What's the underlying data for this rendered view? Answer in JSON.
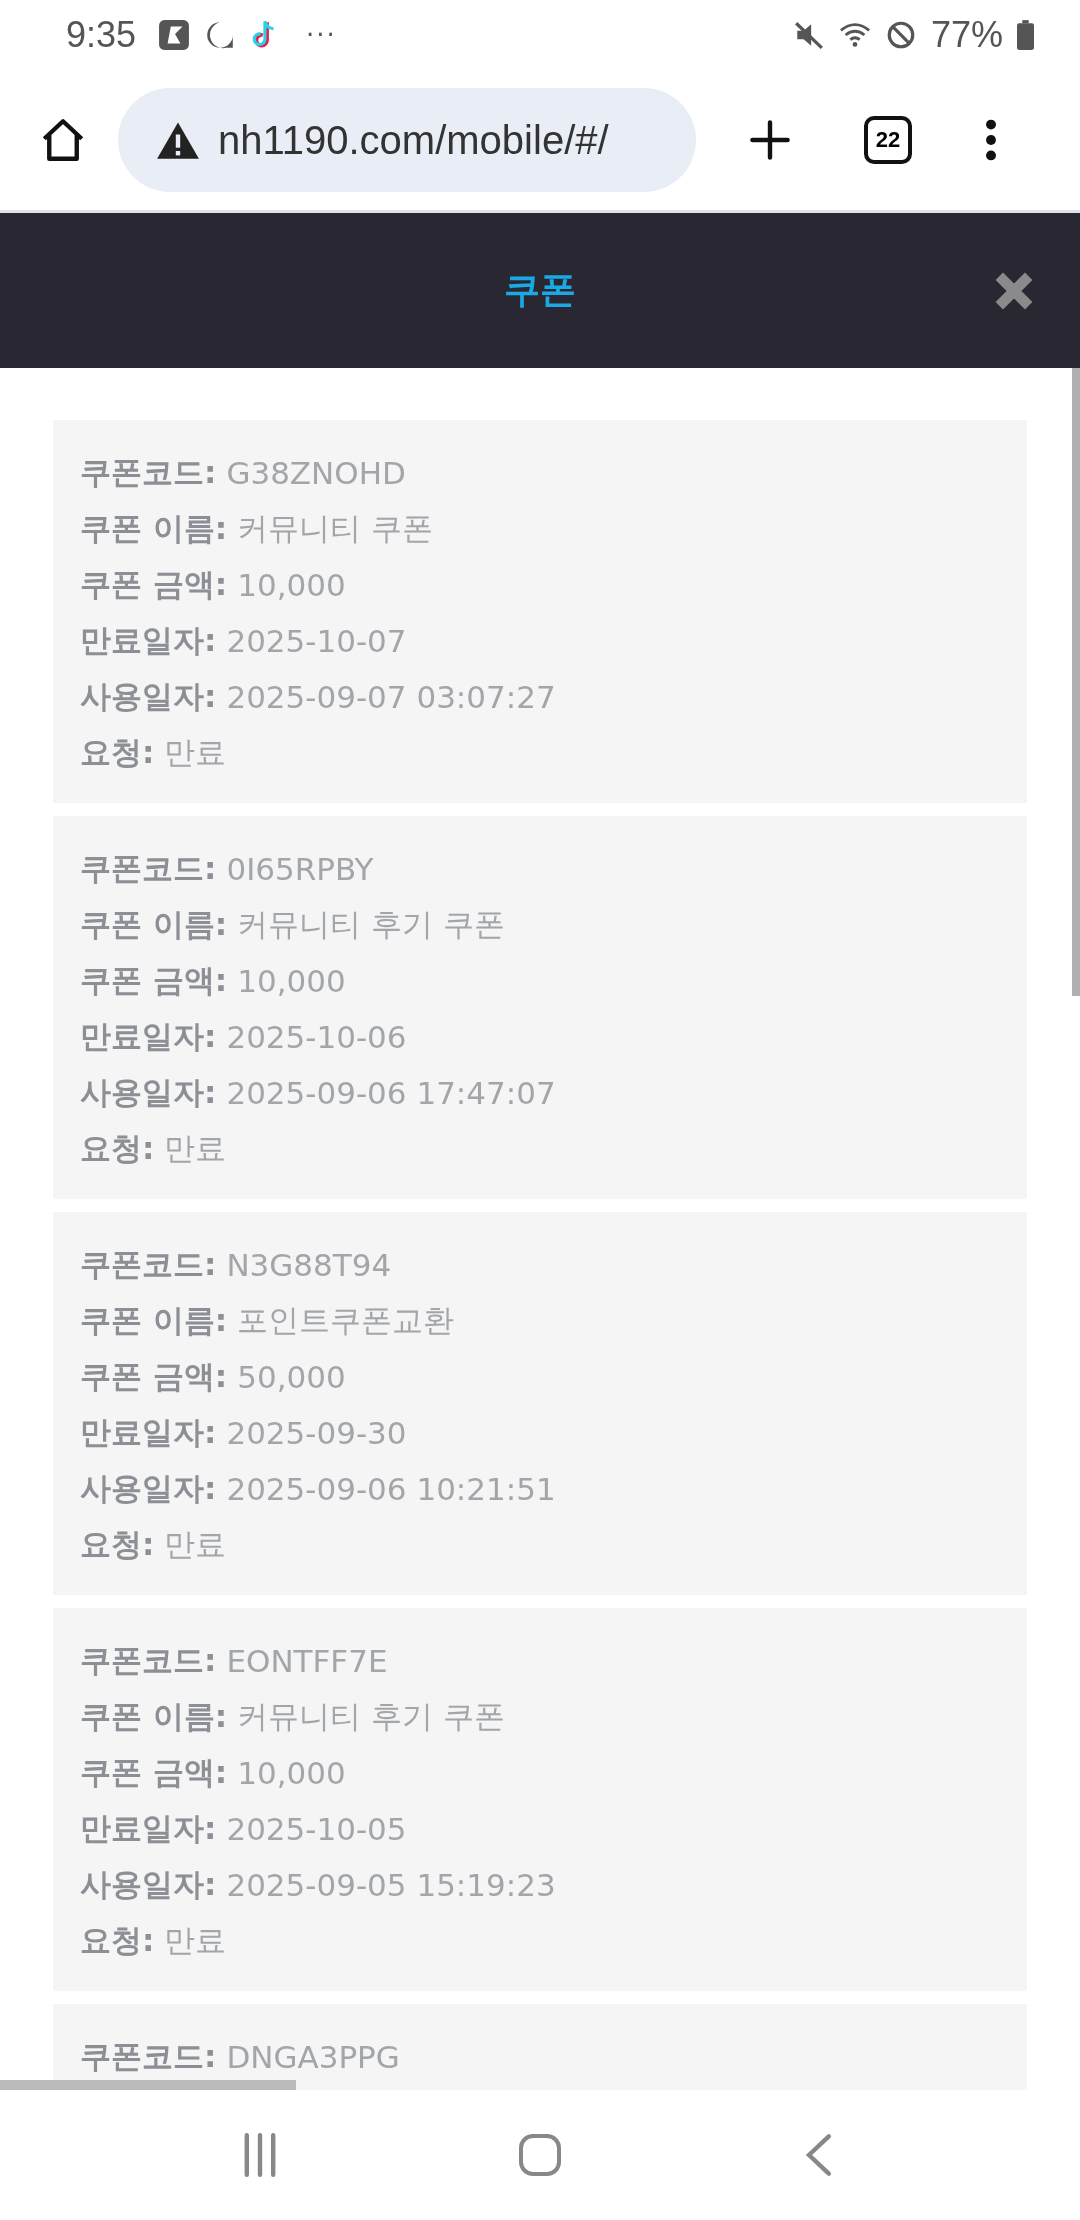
{
  "status_bar": {
    "time": "9:35",
    "more": "···",
    "battery": "77%"
  },
  "browser": {
    "url": "nh1190.com/mobile/#/",
    "tab_count": "22"
  },
  "header": {
    "title": "쿠폰"
  },
  "coupons": [
    {
      "fields": [
        {
          "label": "쿠폰코드:",
          "value": "G38ZNOHD"
        },
        {
          "label": "쿠폰 이름:",
          "value": "커뮤니티 쿠폰"
        },
        {
          "label": "쿠폰 금액:",
          "value": "10,000"
        },
        {
          "label": "만료일자:",
          "value": "2025-10-07"
        },
        {
          "label": "사용일자:",
          "value": "2025-09-07 03:07:27"
        },
        {
          "label": "요청:",
          "value": "만료"
        }
      ]
    },
    {
      "fields": [
        {
          "label": "쿠폰코드:",
          "value": "0I65RPBY"
        },
        {
          "label": "쿠폰 이름:",
          "value": "커뮤니티 후기 쿠폰"
        },
        {
          "label": "쿠폰 금액:",
          "value": "10,000"
        },
        {
          "label": "만료일자:",
          "value": "2025-10-06"
        },
        {
          "label": "사용일자:",
          "value": "2025-09-06 17:47:07"
        },
        {
          "label": "요청:",
          "value": "만료"
        }
      ]
    },
    {
      "fields": [
        {
          "label": "쿠폰코드:",
          "value": "N3G88T94"
        },
        {
          "label": "쿠폰 이름:",
          "value": "포인트쿠폰교환"
        },
        {
          "label": "쿠폰 금액:",
          "value": "50,000"
        },
        {
          "label": "만료일자:",
          "value": "2025-09-30"
        },
        {
          "label": "사용일자:",
          "value": "2025-09-06 10:21:51"
        },
        {
          "label": "요청:",
          "value": "만료"
        }
      ]
    },
    {
      "fields": [
        {
          "label": "쿠폰코드:",
          "value": "EONTFF7E"
        },
        {
          "label": "쿠폰 이름:",
          "value": "커뮤니티 후기 쿠폰"
        },
        {
          "label": "쿠폰 금액:",
          "value": "10,000"
        },
        {
          "label": "만료일자:",
          "value": "2025-10-05"
        },
        {
          "label": "사용일자:",
          "value": "2025-09-05 15:19:23"
        },
        {
          "label": "요청:",
          "value": "만료"
        }
      ]
    },
    {
      "fields": [
        {
          "label": "쿠폰코드:",
          "value": "DNGA3PPG"
        }
      ]
    }
  ]
}
